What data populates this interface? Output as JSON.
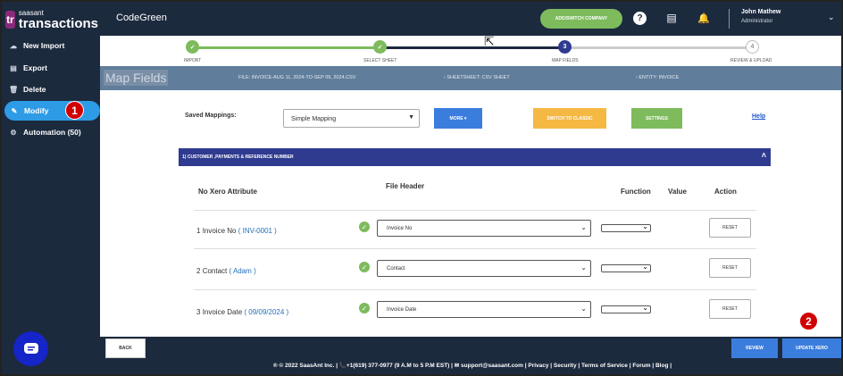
{
  "brand": {
    "small": "saasant",
    "big": "transactions",
    "box": "tr"
  },
  "sidebar": {
    "items": [
      {
        "label": "New Import",
        "icon": "cloud-upload-icon"
      },
      {
        "label": "Export",
        "icon": "export-icon"
      },
      {
        "label": "Delete",
        "icon": "trash-icon"
      },
      {
        "label": "Modify",
        "icon": "edit-icon",
        "active": true
      },
      {
        "label": "Automation (50)",
        "icon": "gears-icon"
      }
    ]
  },
  "annotations": {
    "one": "1",
    "two": "2"
  },
  "header": {
    "company": "CodeGreen",
    "add_switch": "ADD/SWITCH COMPANY",
    "user_name": "John Mathew",
    "user_role": "Administrator"
  },
  "steps": [
    {
      "label": "IMPORT",
      "state": "done",
      "number": "1"
    },
    {
      "label": "SELECT SHEET",
      "state": "done",
      "number": "2"
    },
    {
      "label": "MAP FIELDS",
      "state": "current",
      "number": "3"
    },
    {
      "label": "REVIEW & UPLOAD",
      "state": "todo",
      "number": "4"
    }
  ],
  "mapbar": {
    "title": "Map Fields",
    "file": "FILE: INVOICE-AUG 11, 2024-TO-SEP 09, 2024.CSV",
    "sheet_label": "SHEETSHEET:",
    "sheet_value": "CSV SHEET",
    "entity": "ENTITY: INVOICE"
  },
  "mapping": {
    "saved_label": "Saved Mappings:",
    "saved_value": "Simple Mapping",
    "more": "MORE ▾",
    "switch": "SWITCH TO CLASSIC",
    "settings": "SETTINGS",
    "help": "Help"
  },
  "section": {
    "title": "1) CUSTOMER ,PAYMENTS & REFERENCE NUMBER"
  },
  "columns": {
    "no_attr": "No  Xero Attribute",
    "file_header": "File Header",
    "function": "Function",
    "value": "Value",
    "action": "Action"
  },
  "rows": [
    {
      "no": "1",
      "attr": "Invoice No",
      "example": "( INV-0001 )",
      "header": "Invoice No",
      "action": "RESET"
    },
    {
      "no": "2",
      "attr": "Contact",
      "example": "( Adam )",
      "header": "Contact",
      "action": "RESET"
    },
    {
      "no": "3",
      "attr": "Invoice Date",
      "example": "( 09/09/2024 )",
      "header": "Invoice Date",
      "action": "RESET"
    }
  ],
  "footer": {
    "back": "BACK",
    "review": "REVIEW",
    "update": "UPDATE XERO",
    "copyright": "® © 2022 SaasAnt Inc.  | 📞+1(619) 377-0977 (9 A.M to 5 P.M EST)  | ✉ support@saasant.com | Privacy | Security | Terms of Service | Forum | Blog |"
  },
  "colors": {
    "sidebar": "#1c2a3e",
    "active": "#2e9be6",
    "green": "#7dbb5d",
    "blue_btn": "#3b7ddd",
    "orange": "#f5b843",
    "section": "#2f3b8f"
  }
}
